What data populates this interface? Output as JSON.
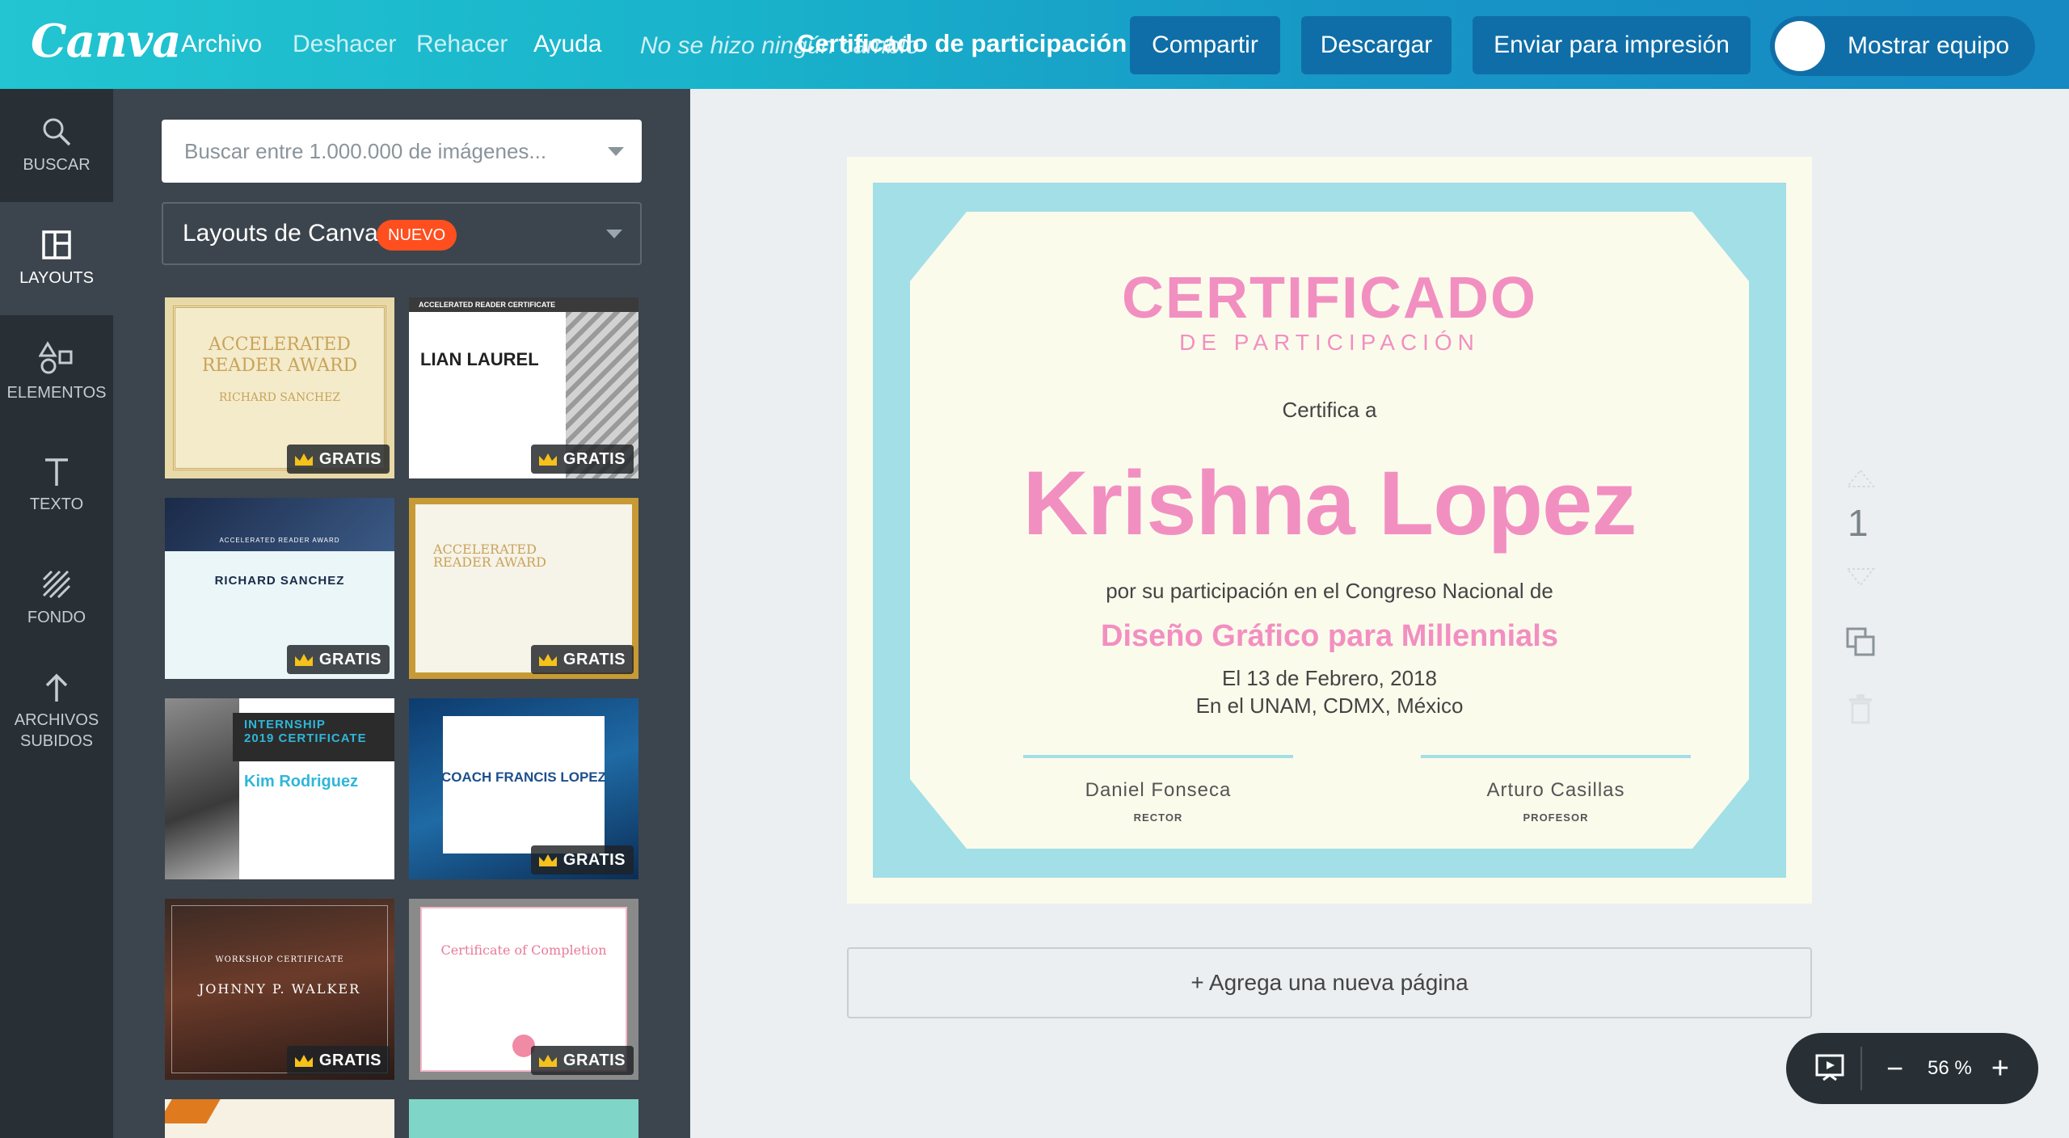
{
  "app": {
    "logo": "Canva"
  },
  "menu": {
    "archivo": "Archivo",
    "deshacer": "Deshacer",
    "rehacer": "Rehacer",
    "ayuda": "Ayuda"
  },
  "header": {
    "save_status": "No se hizo ningún cambio",
    "doc_title": "Certificado de participación",
    "share": "Compartir",
    "download": "Descargar",
    "print": "Enviar para impresión",
    "team": "Mostrar equipo"
  },
  "nav": {
    "search": "BUSCAR",
    "layouts": "LAYOUTS",
    "elements": "ELEMENTOS",
    "text": "TEXTO",
    "background": "FONDO",
    "uploads_1": "ARCHIVOS",
    "uploads_2": "SUBIDOS"
  },
  "panel": {
    "search_placeholder": "Buscar entre 1.000.000 de imágenes...",
    "layouts_label": "Layouts de Canva",
    "new_badge": "NUEVO",
    "gratis": "GRATIS",
    "templates": [
      {
        "title": "ACCELERATED\nREADER AWARD",
        "sub": "RICHARD SANCHEZ"
      },
      {
        "title": "LIAN LAUREL",
        "sub": "ACCELERATED READER CERTIFICATE"
      },
      {
        "title": "RICHARD SANCHEZ",
        "sub": "ACCELERATED READER AWARD"
      },
      {
        "title": "ACCELERATED\nREADER AWARD",
        "sub": ""
      },
      {
        "title": "Kim Rodriguez",
        "sub": "INTERNSHIP\n2019 CERTIFICATE"
      },
      {
        "title": "COACH FRANCIS LOPEZ",
        "sub": ""
      },
      {
        "title": "JOHNNY P. WALKER",
        "sub": "WORKSHOP CERTIFICATE"
      },
      {
        "title": "Certificate of Completion",
        "sub": ""
      }
    ]
  },
  "certificate": {
    "title": "CERTIFICADO",
    "subtitle": "DE PARTICIPACIÓN",
    "certifies": "Certifica a",
    "name": "Krishna Lopez",
    "for": "por su participación en el Congreso Nacional de",
    "event": "Diseño Gráfico para Millennials",
    "date": "El 13 de Febrero, 2018",
    "place": "En el UNAM, CDMX, México",
    "signer1_name": "Daniel Fonseca",
    "signer1_role": "RECTOR",
    "signer2_name": "Arturo Casillas",
    "signer2_role": "PROFESOR",
    "colors": {
      "pink": "#f28fc1",
      "teal": "#a3dfe7",
      "cream": "#fbfbec"
    }
  },
  "canvas": {
    "add_page": "+ Agrega una nueva página",
    "page_number": "1"
  },
  "zoom": {
    "minus": "−",
    "value": "56 %",
    "plus": "+"
  }
}
